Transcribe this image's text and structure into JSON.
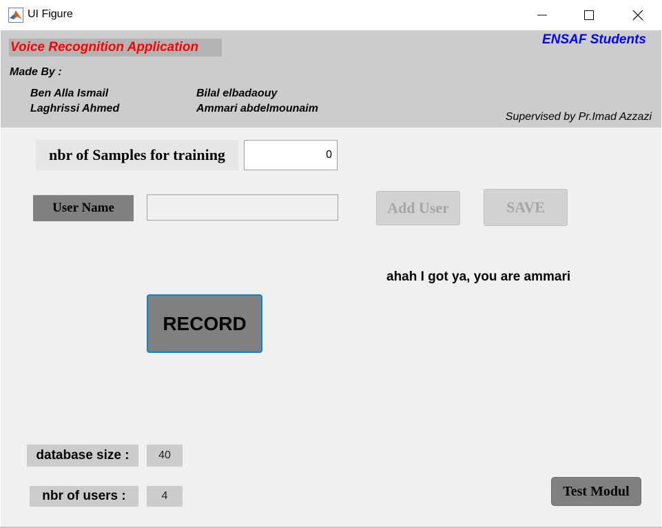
{
  "window": {
    "title": "UI Figure",
    "icon": "matlab-icon",
    "controls": [
      "minimize-icon",
      "maximize-icon",
      "close-icon"
    ]
  },
  "header": {
    "app_title": "Voice Recognition Application",
    "org": "ENSAF Students",
    "made_by_label": "Made By :",
    "authors": [
      "Ben Alla Ismail",
      "Laghrissi Ahmed",
      "Bilal elbadaouy",
      "Ammari abdelmounaim"
    ],
    "supervised": "Supervised by Pr.Imad Azzazi"
  },
  "training": {
    "samples_label": "nbr of Samples for training",
    "samples_value": "0"
  },
  "user": {
    "name_label": "User Name",
    "name_value": "",
    "add_user_label": "Add User",
    "save_label": "SAVE"
  },
  "result_text": "ahah I got ya, you are ammari",
  "record_label": "RECORD",
  "stats": {
    "db_label": "database size :",
    "db_value": "40",
    "users_label": "nbr of users :",
    "users_value": "4"
  },
  "test_label": "Test Modul",
  "colors": {
    "title_red": "#ff0000",
    "org_blue": "#0000ff",
    "record_border": "#0a84d9"
  }
}
